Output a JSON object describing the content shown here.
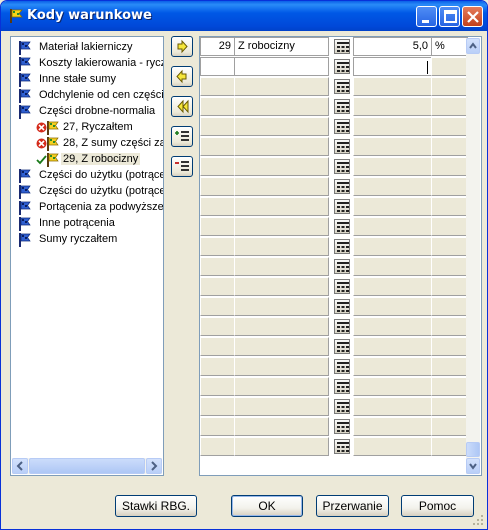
{
  "window": {
    "title": "Kody warunkowe"
  },
  "tree": {
    "items": [
      {
        "label": "Materiał lakierniczy",
        "icon": "blue-flag-icon",
        "level": 0,
        "status": "none"
      },
      {
        "label": "Koszty lakierowania - rycz",
        "icon": "blue-flag-icon",
        "level": 0,
        "status": "none"
      },
      {
        "label": "Inne stałe sumy",
        "icon": "blue-flag-icon",
        "level": 0,
        "status": "none"
      },
      {
        "label": "Odchylenie od cen części",
        "icon": "blue-flag-icon",
        "level": 0,
        "status": "none"
      },
      {
        "label": "Części drobne-normalia",
        "icon": "blue-flag-icon",
        "level": 0,
        "status": "none"
      },
      {
        "label": "27, Ryczałtem",
        "icon": "yellow-flag-icon",
        "level": 1,
        "status": "error"
      },
      {
        "label": "28, Z sumy części za",
        "icon": "yellow-flag-icon",
        "level": 1,
        "status": "error"
      },
      {
        "label": "29, Z robocizny",
        "icon": "yellow-flag-icon",
        "level": 1,
        "status": "check",
        "selected": true
      },
      {
        "label": "Części do użytku (potrące",
        "icon": "blue-flag-icon",
        "level": 0,
        "status": "none"
      },
      {
        "label": "Części do użytku (potrące",
        "icon": "blue-flag-icon",
        "level": 0,
        "status": "none"
      },
      {
        "label": "Portącenia za podwyższe",
        "icon": "blue-flag-icon",
        "level": 0,
        "status": "none"
      },
      {
        "label": "Inne potrącenia",
        "icon": "blue-flag-icon",
        "level": 0,
        "status": "none"
      },
      {
        "label": "Sumy ryczałtem",
        "icon": "blue-flag-icon",
        "level": 0,
        "status": "none"
      }
    ]
  },
  "side_buttons": [
    {
      "name": "add-right-button",
      "icon": "arrow-right-icon"
    },
    {
      "name": "remove-left-button",
      "icon": "arrow-left-icon"
    },
    {
      "name": "remove-all-button",
      "icon": "double-arrow-left-icon"
    },
    {
      "name": "insert-row-button",
      "icon": "insert-list-icon"
    },
    {
      "name": "delete-row-button",
      "icon": "delete-list-icon"
    }
  ],
  "grid": {
    "rows": [
      {
        "code": "29",
        "name": "Z robocizny",
        "value": "5,0",
        "unit": "%"
      },
      {
        "code": "",
        "name": "",
        "value": "",
        "unit": "",
        "editing": true
      }
    ],
    "total_rows": 21
  },
  "buttons": {
    "rbg": "Stawki RBG.",
    "ok": "OK",
    "cancel": "Przerwanie",
    "help": "Pomoc"
  }
}
